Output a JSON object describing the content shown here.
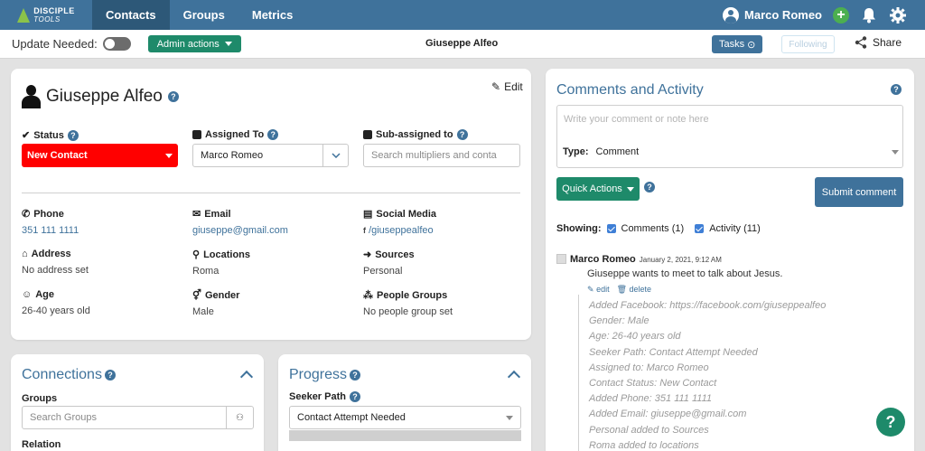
{
  "nav": {
    "logo_line1": "DISCIPLE",
    "logo_line2": "TOOLS",
    "tabs": [
      {
        "label": "Contacts",
        "active": true
      },
      {
        "label": "Groups",
        "active": false
      },
      {
        "label": "Metrics",
        "active": false
      }
    ],
    "user_name": "Marco Romeo"
  },
  "subbar": {
    "update_needed_label": "Update Needed:",
    "admin_actions_label": "Admin actions",
    "page_title": "Giuseppe Alfeo",
    "tasks_label": "Tasks",
    "following_label": "Following",
    "share_label": "Share"
  },
  "details": {
    "name": "Giuseppe Alfeo",
    "edit_label": "Edit",
    "status_label": "Status",
    "status_value": "New Contact",
    "assigned_label": "Assigned To",
    "assigned_value": "Marco Romeo",
    "subassigned_label": "Sub-assigned to",
    "subassigned_placeholder": "Search multipliers and conta",
    "fields": {
      "phone_label": "Phone",
      "phone_value": "351 111 1111",
      "email_label": "Email",
      "email_value": "giuseppe@gmail.com",
      "social_label": "Social Media",
      "social_value": "/giuseppealfeo",
      "address_label": "Address",
      "address_value": "No address set",
      "locations_label": "Locations",
      "locations_value": "Roma",
      "sources_label": "Sources",
      "sources_value": "Personal",
      "age_label": "Age",
      "age_value": "26-40 years old",
      "gender_label": "Gender",
      "gender_value": "Male",
      "people_groups_label": "People Groups",
      "people_groups_value": "No people group set"
    }
  },
  "comments": {
    "title": "Comments and Activity",
    "placeholder": "Write your comment or note here",
    "type_label": "Type:",
    "type_value": "Comment",
    "quick_actions_label": "Quick Actions",
    "submit_label": "Submit comment",
    "showing_label": "Showing:",
    "filter_comments": "Comments (1)",
    "filter_activity": "Activity (11)",
    "entry": {
      "author": "Marco Romeo",
      "date": "January 2, 2021, 9:12 AM",
      "text": "Giuseppe wants to meet to talk about Jesus.",
      "edit_label": "edit",
      "delete_label": "delete"
    },
    "activity": [
      "Added Facebook: https://facebook.com/giuseppealfeo",
      "Gender: Male",
      "Age: 26-40 years old",
      "Seeker Path: Contact Attempt Needed",
      "Assigned to: Marco Romeo",
      "Contact Status: New Contact",
      "Added Phone: 351 111 1111",
      "Added Email: giuseppe@gmail.com",
      "Personal added to Sources",
      "Roma added to locations"
    ]
  },
  "connections": {
    "title": "Connections",
    "groups_label": "Groups",
    "groups_placeholder": "Search Groups",
    "relation_label": "Relation"
  },
  "progress": {
    "title": "Progress",
    "seeker_path_label": "Seeker Path",
    "seeker_path_value": "Contact Attempt Needed"
  },
  "help_label": "?",
  "colors": {
    "nav_bg": "#3f729b",
    "nav_active": "#2d5878",
    "teal": "#1e8a6a",
    "status_red": "#ff0000",
    "link_blue": "#3f729b"
  }
}
